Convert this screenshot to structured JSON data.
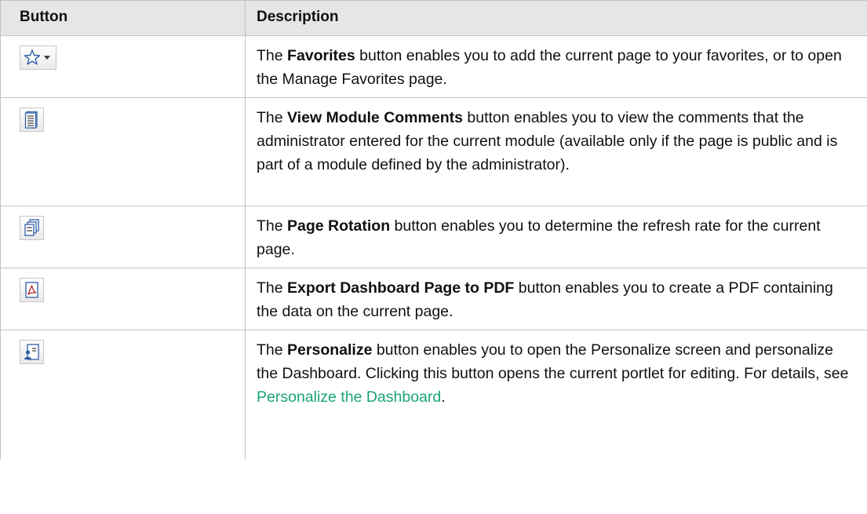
{
  "table": {
    "headers": {
      "button": "Button",
      "description": "Description"
    },
    "rows": [
      {
        "icon": "favorites-star-dropdown-icon",
        "pre": "The ",
        "term": "Favorites",
        "post": " button enables you to add the current page to your favorites, or to open the Manage Favorites page."
      },
      {
        "icon": "view-module-comments-icon",
        "pre": "The ",
        "term": "View Module Comments",
        "post": " button enables you to view the comments that the administrator entered for the current module (available only if the page is public and is part of a module defined by the administrator)."
      },
      {
        "icon": "page-rotation-icon",
        "pre": "The ",
        "term": "Page Rotation",
        "post": " button enables you to determine the refresh rate for the current page."
      },
      {
        "icon": "export-pdf-icon",
        "pre": "The ",
        "term": "Export Dashboard Page to PDF",
        "post": " button enables you to create a PDF containing the data on the current page."
      },
      {
        "icon": "personalize-icon",
        "pre": "The ",
        "term": "Personalize",
        "post": " button enables you to open the Personalize screen and personalize the Dashboard. Clicking this button opens the current portlet for editing. For details, see ",
        "link": "Personalize the Dashboard",
        "end": "."
      }
    ]
  },
  "colors": {
    "header_bg": "#e6e6e6",
    "border": "#c2c2c2",
    "link": "#1aa37a",
    "icon_blue": "#2f5fa8"
  }
}
